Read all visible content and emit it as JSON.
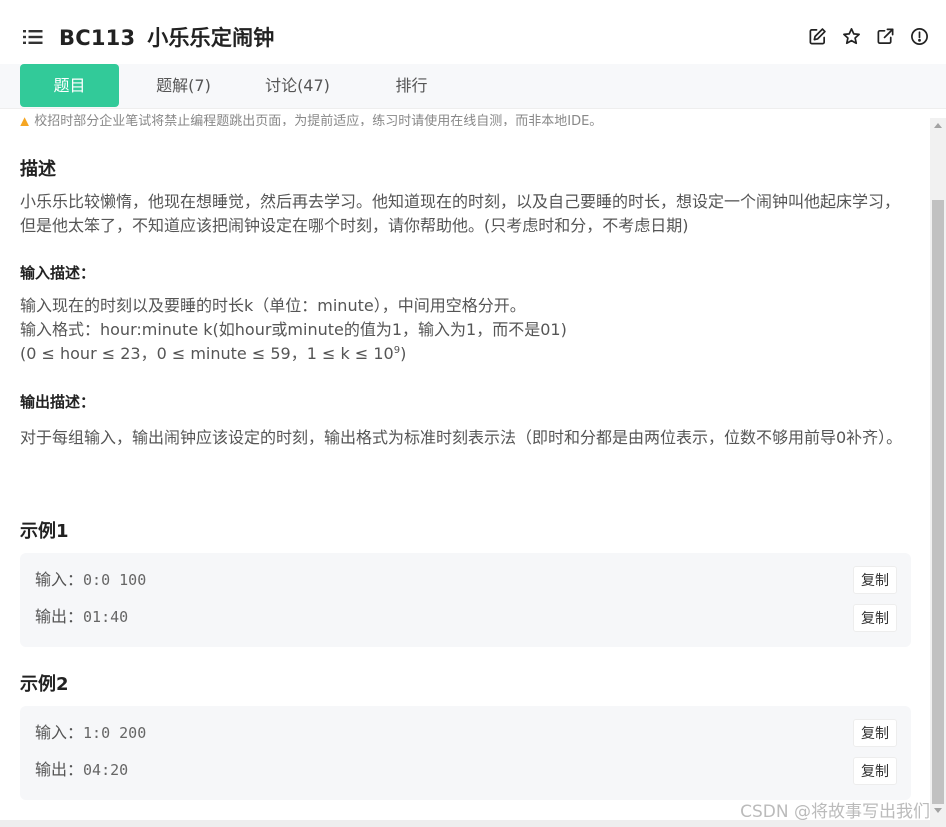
{
  "header": {
    "problem_id": "BC113",
    "problem_title": "小乐乐定闹钟",
    "icons": [
      "edit-icon",
      "star-icon",
      "open-external-icon",
      "report-icon"
    ]
  },
  "tabs": [
    {
      "label": "题目",
      "active": true
    },
    {
      "label": "题解(7)",
      "active": false
    },
    {
      "label": "讨论(47)",
      "active": false
    },
    {
      "label": "排行",
      "active": false
    }
  ],
  "notice": "校招时部分企业笔试将禁止编程题跳出页面，为提前适应，练习时请使用在线自测，而非本地IDE。",
  "description": {
    "heading": "描述",
    "text": "小乐乐比较懒惰，他现在想睡觉，然后再去学习。他知道现在的时刻，以及自己要睡的时长，想设定一个闹钟叫他起床学习，但是他太笨了，不知道应该把闹钟设定在哪个时刻，请你帮助他。(只考虑时和分，不考虑日期)"
  },
  "input_desc": {
    "heading": "输入描述：",
    "line1": "输入现在的时刻以及要睡的时长k（单位：minute），中间用空格分开。",
    "line2": "输入格式：hour:minute k(如hour或minute的值为1，输入为1，而不是01)",
    "line3_main": "(0 ≤ hour ≤ 23，0 ≤ minute ≤ 59，1 ≤ k ≤ 10",
    "line3_sup": "9",
    "line3_end": ")"
  },
  "output_desc": {
    "heading": "输出描述：",
    "text": "对于每组输入，输出闹钟应该设定的时刻，输出格式为标准时刻表示法（即时和分都是由两位表示，位数不够用前导0补齐）。"
  },
  "examples": [
    {
      "heading": "示例1",
      "input_label": "输入：",
      "input": "0:0 100",
      "output_label": "输出：",
      "output": "01:40",
      "copy_label": "复制"
    },
    {
      "heading": "示例2",
      "input_label": "输入：",
      "input": "1:0 200",
      "output_label": "输出：",
      "output": "04:20",
      "copy_label": "复制"
    }
  ],
  "watermark": "CSDN @将故事写出我们",
  "colors": {
    "accent": "#32ca99",
    "text": "#333333",
    "muted": "#888888",
    "example_bg": "#f6f7f9"
  }
}
